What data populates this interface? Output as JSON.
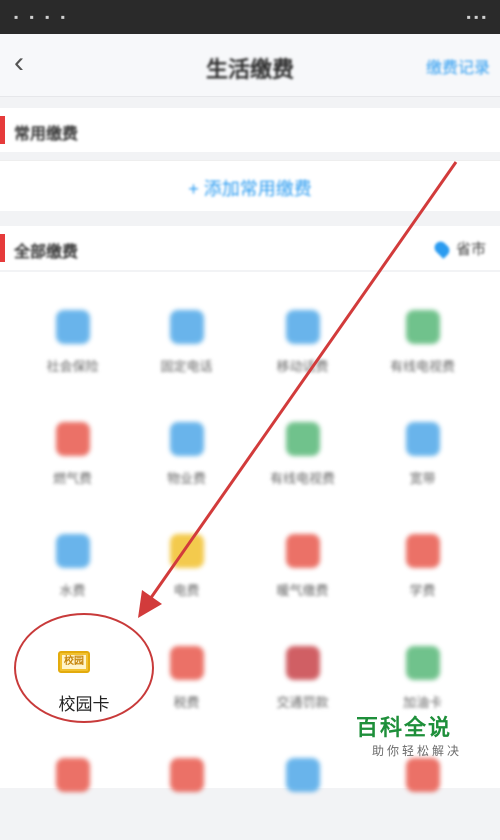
{
  "nav": {
    "back_glyph": "‹",
    "title": "生活缴费",
    "records_link": "缴费记录"
  },
  "sections": {
    "frequent": {
      "label": "常用缴费"
    },
    "all": {
      "label": "全部缴费",
      "region": "省市"
    }
  },
  "add_frequent": "+ 添加常用缴费",
  "tiles": [
    {
      "label": "社会保险",
      "icon": "shield-icon",
      "color": "#4fa8e8"
    },
    {
      "label": "固定电话",
      "icon": "store-icon",
      "color": "#4fa8e8"
    },
    {
      "label": "移动话费",
      "icon": "phone-icon",
      "color": "#4fa8e8"
    },
    {
      "label": "有线电视费",
      "icon": "leaf-icon",
      "color": "#58b878"
    },
    {
      "label": "燃气费",
      "icon": "flame-icon",
      "color": "#e8594d"
    },
    {
      "label": "物业费",
      "icon": "document-icon",
      "color": "#4fa8e8"
    },
    {
      "label": "有线电视费",
      "icon": "tv-icon",
      "color": "#58b878"
    },
    {
      "label": "宽带",
      "icon": "globe-icon",
      "color": "#4fa8e8"
    },
    {
      "label": "水费",
      "icon": "water-drop-icon",
      "color": "#4fa8e8"
    },
    {
      "label": "电费",
      "icon": "lightbulb-icon",
      "color": "#f2c12e"
    },
    {
      "label": "暖气缴费",
      "icon": "heater-icon",
      "color": "#e8594d"
    },
    {
      "label": "学费",
      "icon": "tuition-icon",
      "color": "#e8594d"
    },
    {
      "label": "税费",
      "icon": "tax-icon",
      "color": "#e8594d"
    },
    {
      "label": "交通罚款",
      "icon": "fine-icon",
      "color": "#c8444a"
    },
    {
      "label": "加油卡",
      "icon": "fuel-card-icon",
      "color": "#58b878"
    },
    {
      "label": "",
      "icon": "grid-icon",
      "color": "#e8594d"
    },
    {
      "label": "",
      "icon": "grid-icon",
      "color": "#e8594d"
    },
    {
      "label": "",
      "icon": "grid-icon",
      "color": "#4fa8e8"
    },
    {
      "label": "",
      "icon": "grid-icon",
      "color": "#e8594d"
    }
  ],
  "campus_card": {
    "badge": "校园",
    "label": "校园卡",
    "icon": "campus-card-icon"
  },
  "watermark": {
    "title": "百科全说",
    "subtitle": "助你轻松解决"
  },
  "colors": {
    "accent": "#2a9bf0",
    "section_bar": "#e63b3b",
    "annotation": "#c83a3a"
  }
}
